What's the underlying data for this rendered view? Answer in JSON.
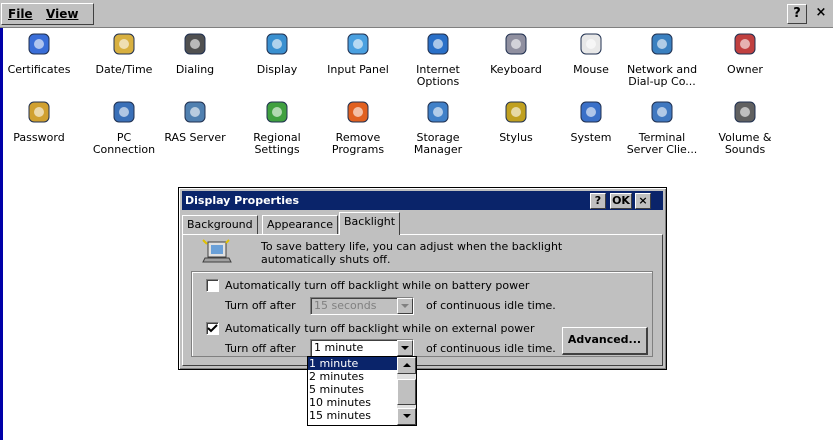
{
  "menubar": {
    "file_label": "File",
    "view_label": "View",
    "help_button": "?",
    "close_button": "×"
  },
  "control_panel_items": [
    {
      "label": "Certificates",
      "icon": "certificates-icon"
    },
    {
      "label": "Date/Time",
      "icon": "date-time-icon"
    },
    {
      "label": "Dialing",
      "icon": "dialing-icon"
    },
    {
      "label": "Display",
      "icon": "display-icon"
    },
    {
      "label": "Input Panel",
      "icon": "input-panel-icon"
    },
    {
      "label": "Internet Options",
      "icon": "internet-options-icon"
    },
    {
      "label": "Keyboard",
      "icon": "keyboard-icon"
    },
    {
      "label": "Mouse",
      "icon": "mouse-icon"
    },
    {
      "label": "Network and Dial-up Co...",
      "icon": "network-icon"
    },
    {
      "label": "Owner",
      "icon": "owner-icon"
    },
    {
      "label": "Password",
      "icon": "password-icon"
    },
    {
      "label": "PC Connection",
      "icon": "pc-connection-icon"
    },
    {
      "label": "RAS Server",
      "icon": "ras-server-icon"
    },
    {
      "label": "Regional Settings",
      "icon": "regional-settings-icon"
    },
    {
      "label": "Remove Programs",
      "icon": "remove-programs-icon"
    },
    {
      "label": "Storage Manager",
      "icon": "storage-manager-icon"
    },
    {
      "label": "Stylus",
      "icon": "stylus-icon"
    },
    {
      "label": "System",
      "icon": "system-icon"
    },
    {
      "label": "Terminal Server Clie...",
      "icon": "terminal-server-icon"
    },
    {
      "label": "Volume & Sounds",
      "icon": "volume-sounds-icon"
    }
  ],
  "dialog": {
    "title": "Display Properties",
    "help_button": "?",
    "ok_button": "OK",
    "close_button": "×",
    "tabs": [
      "Background",
      "Appearance",
      "Backlight"
    ],
    "active_tab": "Backlight",
    "info_text_line1": "To save battery life, you can adjust when the backlight",
    "info_text_line2": "automatically shuts off.",
    "battery": {
      "checkbox_label": "Automatically turn off backlight while on battery power",
      "checked": false,
      "turn_off_label": "Turn off after",
      "selected_value": "15 seconds",
      "suffix": "of continuous idle time."
    },
    "external": {
      "checkbox_label": "Automatically turn off backlight while on external power",
      "checked": true,
      "turn_off_label": "Turn off after",
      "selected_value": "1 minute",
      "suffix": "of continuous idle time."
    },
    "advanced_button": "Advanced...",
    "dropdown_options": [
      "1 minute",
      "2 minutes",
      "5 minutes",
      "10 minutes",
      "15 minutes"
    ]
  },
  "colors": {
    "titlebar": "#0a246a",
    "window_bg": "#c0c0c0",
    "selection": "#0a246a"
  }
}
